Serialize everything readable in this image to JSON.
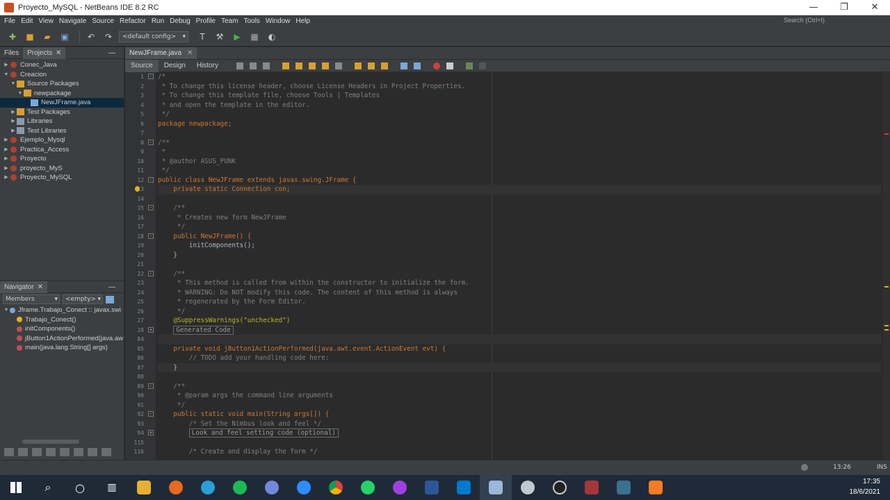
{
  "window": {
    "title": "Proyecto_MySQL - NetBeans IDE 8.2 RC"
  },
  "menu": [
    "File",
    "Edit",
    "View",
    "Navigate",
    "Source",
    "Refactor",
    "Run",
    "Debug",
    "Profile",
    "Team",
    "Tools",
    "Window",
    "Help"
  ],
  "search": {
    "placeholder": "Search (Ctrl+I)"
  },
  "toolbar": {
    "config": "<default config>"
  },
  "projects_panel": {
    "tabs": [
      "Files",
      "Projects"
    ],
    "tree": [
      {
        "label": "Conec_Java",
        "level": 0,
        "arrow": "▶",
        "icon": "proj"
      },
      {
        "label": "Creacion",
        "level": 0,
        "arrow": "▼",
        "icon": "proj"
      },
      {
        "label": "Source Packages",
        "level": 1,
        "arrow": "▼",
        "icon": "pkg"
      },
      {
        "label": "newpackage",
        "level": 2,
        "arrow": "▼",
        "icon": "pkg"
      },
      {
        "label": "NewJFrame.java",
        "level": 3,
        "arrow": "",
        "icon": "file",
        "selected": true
      },
      {
        "label": "Test Packages",
        "level": 1,
        "arrow": "▶",
        "icon": "pkg"
      },
      {
        "label": "Libraries",
        "level": 1,
        "arrow": "▶",
        "icon": "lib"
      },
      {
        "label": "Test Libraries",
        "level": 1,
        "arrow": "▶",
        "icon": "lib"
      },
      {
        "label": "Ejemplo_Mysql",
        "level": 0,
        "arrow": "▶",
        "icon": "proj"
      },
      {
        "label": "Practica_Access",
        "level": 0,
        "arrow": "▶",
        "icon": "proj"
      },
      {
        "label": "Proyecto",
        "level": 0,
        "arrow": "▶",
        "icon": "proj"
      },
      {
        "label": "proyecto_MyS",
        "level": 0,
        "arrow": "▶",
        "icon": "proj"
      },
      {
        "label": "Proyecto_MySQL",
        "level": 0,
        "arrow": "▶",
        "icon": "proj"
      }
    ]
  },
  "navigator": {
    "title": "Navigator",
    "filter": "Members",
    "empty": "<empty>",
    "items": [
      {
        "label": "Jframe.Trabajo_Conect :: javax.swi",
        "level": 0
      },
      {
        "label": "Trabajo_Conect()",
        "level": 1
      },
      {
        "label": "initComponents()",
        "level": 1
      },
      {
        "label": "jButton1ActionPerformed(java.aw",
        "level": 1
      },
      {
        "label": "main(java.lang.String[] args)",
        "level": 1
      }
    ]
  },
  "editor": {
    "tab": "NewJFrame.java",
    "views": [
      "Source",
      "Design",
      "History"
    ],
    "line_numbers": [
      "1",
      "2",
      "3",
      "4",
      "5",
      "6",
      "7",
      "8",
      "9",
      "10",
      "11",
      "12",
      "13",
      "14",
      "15",
      "16",
      "17",
      "18",
      "19",
      "20",
      "21",
      "22",
      "23",
      "24",
      "25",
      "26",
      "27",
      "28",
      "84",
      "85",
      "86",
      "87",
      "88",
      "89",
      "90",
      "91",
      "92",
      "93",
      "94",
      "115",
      "116"
    ],
    "code": [
      "/*",
      " * To change this license header, choose License Headers in Project Properties.",
      " * To change this template file, choose Tools | Templates",
      " * and open the template in the editor.",
      " */",
      "package newpackage;",
      "",
      "/**",
      " *",
      " * @author ASUS_PUNK",
      " */",
      "public class NewJFrame extends javax.swing.JFrame {",
      "    private static Connection con;",
      "",
      "    /**",
      "     * Creates new form NewJFrame",
      "     */",
      "    public NewJFrame() {",
      "        initComponents();",
      "    }",
      "",
      "    /**",
      "     * This method is called from within the constructor to initialize the form.",
      "     * WARNING: Do NOT modify this code. The content of this method is always",
      "     * regenerated by the Form Editor.",
      "     */",
      "    @SuppressWarnings(\"unchecked\")",
      "    Generated Code",
      "",
      "    private void jButton1ActionPerformed(java.awt.event.ActionEvent evt) {",
      "        // TODO add your handling code here:",
      "    }",
      "",
      "    /**",
      "     * @param args the command line arguments",
      "     */",
      "    public static void main(String args[]) {",
      "        /* Set the Nimbus look and feel */",
      "        Look and feel setting code (optional)",
      "",
      "        /* Create and display the form */"
    ]
  },
  "status": {
    "position": "13:26",
    "mode": "INS"
  },
  "tray": {
    "time": "17:35",
    "date": "18/6/2021"
  }
}
